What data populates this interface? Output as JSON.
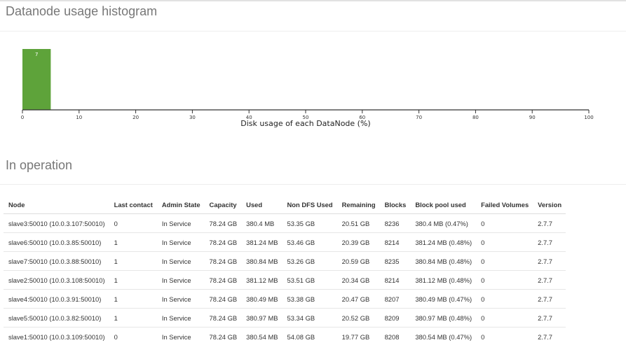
{
  "histogram_section": {
    "title": "Datanode usage histogram"
  },
  "chart_data": {
    "type": "bar",
    "title": "",
    "xlabel": "Disk usage of each DataNode (%)",
    "ylabel": "",
    "x_ticks": [
      0,
      10,
      20,
      30,
      40,
      50,
      60,
      70,
      80,
      90,
      100
    ],
    "xlim": [
      0,
      100
    ],
    "bins": [
      {
        "from": 0,
        "to": 5,
        "count": 7,
        "label": "7"
      }
    ],
    "bar_color": "#5ea33a",
    "grid": false
  },
  "operation_section": {
    "title": "In operation"
  },
  "table": {
    "headers": [
      "Node",
      "Last contact",
      "Admin State",
      "Capacity",
      "Used",
      "Non DFS Used",
      "Remaining",
      "Blocks",
      "Block pool used",
      "Failed Volumes",
      "Version"
    ],
    "rows": [
      [
        "slave3:50010 (10.0.3.107:50010)",
        "0",
        "In Service",
        "78.24 GB",
        "380.4 MB",
        "53.35 GB",
        "20.51 GB",
        "8236",
        "380.4 MB (0.47%)",
        "0",
        "2.7.7"
      ],
      [
        "slave6:50010 (10.0.3.85:50010)",
        "1",
        "In Service",
        "78.24 GB",
        "381.24 MB",
        "53.46 GB",
        "20.39 GB",
        "8214",
        "381.24 MB (0.48%)",
        "0",
        "2.7.7"
      ],
      [
        "slave7:50010 (10.0.3.88:50010)",
        "1",
        "In Service",
        "78.24 GB",
        "380.84 MB",
        "53.26 GB",
        "20.59 GB",
        "8235",
        "380.84 MB (0.48%)",
        "0",
        "2.7.7"
      ],
      [
        "slave2:50010 (10.0.3.108:50010)",
        "1",
        "In Service",
        "78.24 GB",
        "381.12 MB",
        "53.51 GB",
        "20.34 GB",
        "8214",
        "381.12 MB (0.48%)",
        "0",
        "2.7.7"
      ],
      [
        "slave4:50010 (10.0.3.91:50010)",
        "1",
        "In Service",
        "78.24 GB",
        "380.49 MB",
        "53.38 GB",
        "20.47 GB",
        "8207",
        "380.49 MB (0.47%)",
        "0",
        "2.7.7"
      ],
      [
        "slave5:50010 (10.0.3.82:50010)",
        "1",
        "In Service",
        "78.24 GB",
        "380.97 MB",
        "53.34 GB",
        "20.52 GB",
        "8209",
        "380.97 MB (0.48%)",
        "0",
        "2.7.7"
      ],
      [
        "slave1:50010 (10.0.3.109:50010)",
        "0",
        "In Service",
        "78.24 GB",
        "380.54 MB",
        "54.08 GB",
        "19.77 GB",
        "8208",
        "380.54 MB (0.47%)",
        "0",
        "2.7.7"
      ]
    ]
  }
}
